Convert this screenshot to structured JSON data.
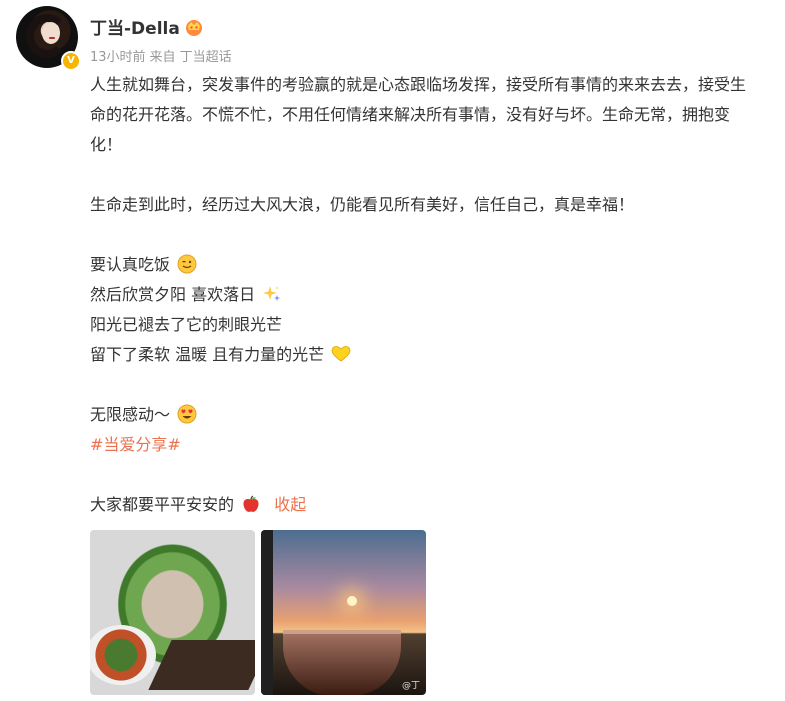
{
  "author": {
    "name": "丁当-Della",
    "verified_badge": "V",
    "crown_icon": "vip-crown-icon"
  },
  "meta": {
    "time": "13小时前",
    "source_prefix": "来自",
    "source": "丁当超话"
  },
  "post": {
    "p1": "人生就如舞台，突发事件的考验赢的就是心态跟临场发挥，接受所有事情的来来去去，接受生命的花开花落。不慌不忙，不用任何情绪来解决所有事情，没有好与坏。生命无常，拥抱变化！",
    "p2": "生命走到此时，经历过大风大浪，仍能看见所有美好，信任自己，真是幸福！",
    "l1": "要认真吃饭",
    "l2": "然后欣赏夕阳 喜欢落日",
    "l3": "阳光已褪去了它的刺眼光芒",
    "l4": "留下了柔软 温暖 且有力量的光芒",
    "l5": "无限感动～",
    "hashtag": "#当爱分享#",
    "l6": "大家都要平平安安的",
    "collapse": "收起"
  },
  "photos": [
    {
      "name": "food-photo"
    },
    {
      "name": "sunset-photo",
      "watermark": "@丁"
    }
  ],
  "colors": {
    "link": "#eb7350",
    "verified": "#f7b500",
    "meta_text": "#999999"
  }
}
